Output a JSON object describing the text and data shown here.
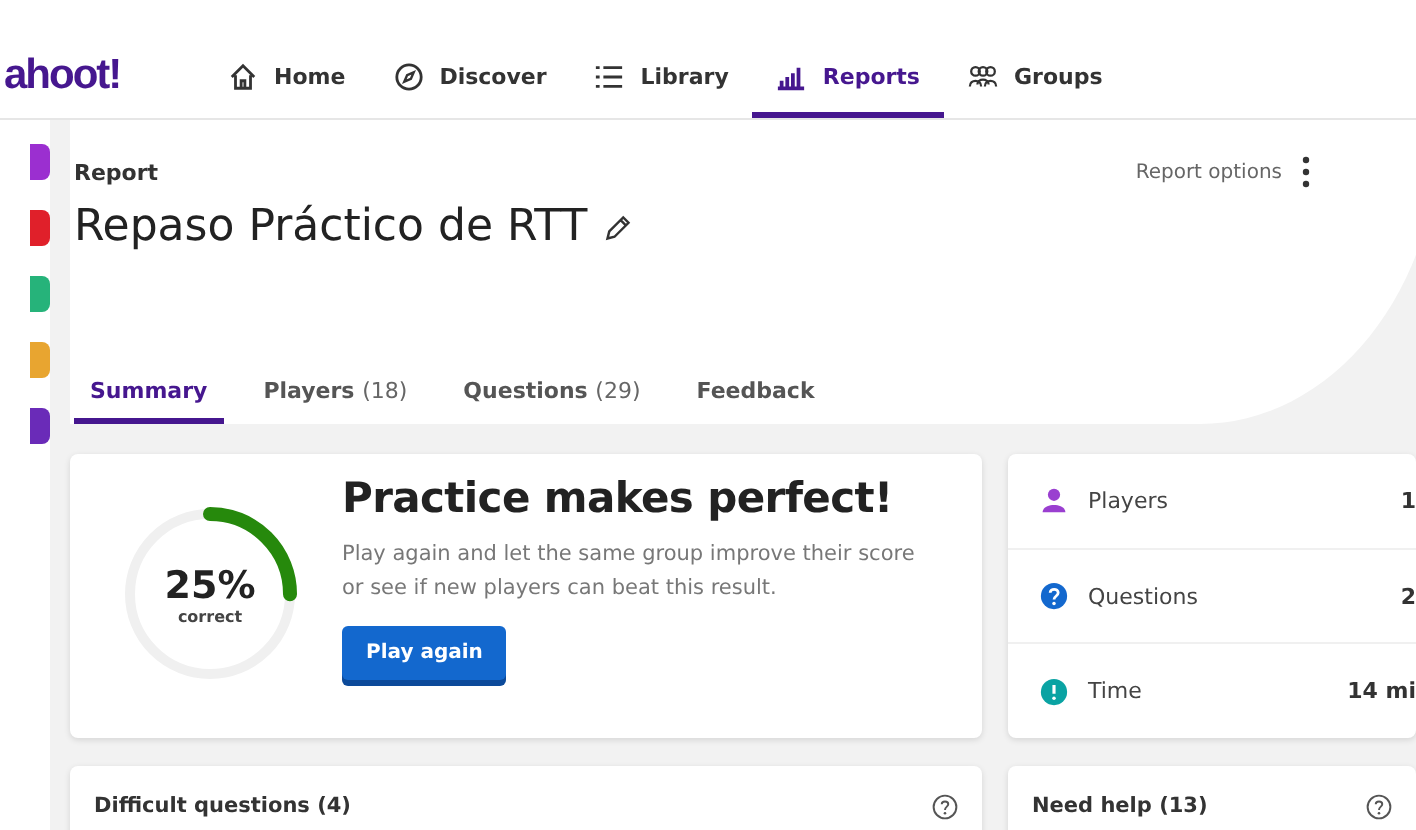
{
  "logo": {
    "text": "ahoot!"
  },
  "nav": [
    {
      "label": "Home",
      "kind": "home",
      "selected": false
    },
    {
      "label": "Discover",
      "kind": "discover",
      "selected": false
    },
    {
      "label": "Library",
      "kind": "library",
      "selected": false
    },
    {
      "label": "Reports",
      "kind": "reports",
      "selected": true
    },
    {
      "label": "Groups",
      "kind": "groups",
      "selected": false
    }
  ],
  "rail": [
    {
      "color": "#9b2fd0"
    },
    {
      "color": "#e0202a"
    },
    {
      "color": "#26b37a"
    },
    {
      "color": "#e8a530"
    },
    {
      "color": "#6a2bb8"
    }
  ],
  "report": {
    "label": "Report",
    "title": "Repaso Práctico de RTT",
    "options": "Report options"
  },
  "tabs": [
    {
      "label": "Summary",
      "selected": true
    },
    {
      "label": "Players",
      "count": "(18)",
      "selected": false
    },
    {
      "label": "Questions",
      "count": "(29)",
      "selected": false
    },
    {
      "label": "Feedback",
      "selected": false
    }
  ],
  "summary": {
    "percent": "25%",
    "caption": "correct",
    "level": 0.25,
    "heading": "Practice makes perfect!",
    "text": "Play again and let the same group improve their score or see if new players can beat this result.",
    "button": "Play again"
  },
  "stats": [
    {
      "kind": "players",
      "label": "Players",
      "value": "1"
    },
    {
      "kind": "questions",
      "label": "Questions",
      "value": "2"
    },
    {
      "kind": "time",
      "label": "Time",
      "value": "14 mi"
    }
  ],
  "bottom": [
    {
      "title": "Difficult questions (4)"
    },
    {
      "title": "Need help (13)"
    }
  ]
}
